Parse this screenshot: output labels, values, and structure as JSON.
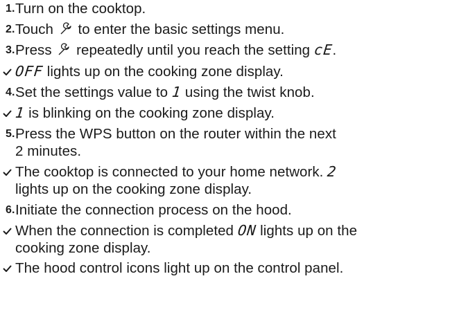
{
  "steps": [
    {
      "marker": "1.",
      "text": "Turn on the cooktop."
    },
    {
      "marker": "2.",
      "pre": "Touch",
      "post": "to enter the basic settings menu."
    },
    {
      "marker": "3.",
      "pre": "Press",
      "post": "repeatedly until you reach the setting",
      "code": "cE",
      "end": "."
    },
    {
      "result": true,
      "code": "OFF",
      "text": "lights up on the cooking zone display."
    },
    {
      "marker": "4.",
      "pre": "Set the settings value to",
      "code": "1",
      "post": "using the twist knob."
    },
    {
      "result": true,
      "code": "1",
      "text": "is blinking on the cooking zone display."
    },
    {
      "marker": "5.",
      "line1": "Press the WPS button on the router within the next",
      "line2": "2 minutes."
    },
    {
      "result": true,
      "line1": "The cooktop is connected to your home network.",
      "code": "2",
      "line2": "lights up on the cooking zone display."
    },
    {
      "marker": "6.",
      "text": "Initiate the connection process on the hood."
    },
    {
      "result": true,
      "pre": "When the connection is completed",
      "code": "ON",
      "post": "lights up on the",
      "line2": "cooking zone display."
    },
    {
      "result": true,
      "text": "The hood control icons light up on the control panel."
    }
  ],
  "icons": {
    "step_marker": "numbered-step",
    "result_marker": "checkmark-icon",
    "settings_symbol": "wrench-icon"
  },
  "colors": {
    "text": "#1a1a1a",
    "background": "#ffffff"
  }
}
